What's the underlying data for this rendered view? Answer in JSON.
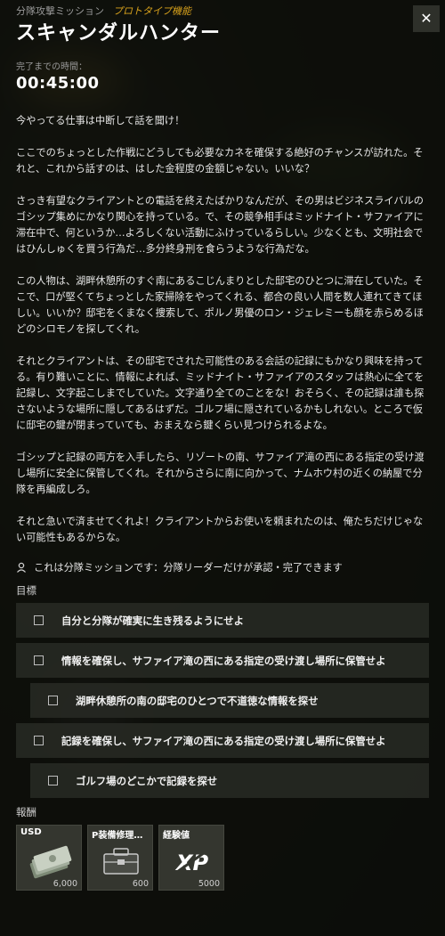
{
  "header": {
    "category": "分隊攻撃ミッション",
    "prototype_tag": "プロトタイプ機能",
    "title": "スキャンダルハンター",
    "close_icon": "close-icon"
  },
  "timer": {
    "label": "完了までの時間：",
    "value": "00:45:00"
  },
  "description": [
    "今やってる仕事は中断して話を聞け！",
    "ここでのちょっとした作戦にどうしても必要なカネを確保する絶好のチャンスが訪れた。それと、これから話すのは、はした金程度の金額じゃない。いいな？",
    "さっき有望なクライアントとの電話を終えたばかりなんだが、その男はビジネスライバルのゴシップ集めにかなり関心を持っている。で、その競争相手はミッドナイト・サファイアに滞在中で、何というか…よろしくない活動にふけっているらしい。少なくとも、文明社会ではひんしゅくを買う行為だ…多分終身刑を食らうような行為だな。",
    "この人物は、湖畔休憩所のすぐ南にあるこじんまりとした邸宅のひとつに滞在していた。そこで、口が堅くてちょっとした家掃除をやってくれる、都合の良い人間を数人連れてきてほしい。いいか？邸宅をくまなく捜索して、ポルノ男優のロン・ジェレミーも顔を赤らめるほどのシロモノを探してくれ。",
    "それとクライアントは、その邸宅でされた可能性のある会話の記録にもかなり興味を持ってる。有り難いことに、情報によれば、ミッドナイト・サファイアのスタッフは熱心に全てを記録し、文字起こしまでしていた。文字通り全てのことをな！おそらく、その記録は誰も探さないような場所に隠してあるはずだ。ゴルフ場に隠されているかもしれない。ところで仮に邸宅の鍵が閉まっていても、おまえなら鍵くらい見つけられるよな。",
    "ゴシップと記録の両方を入手したら、リゾートの南、サファイア滝の西にある指定の受け渡し場所に安全に保管してくれ。それからさらに南に向かって、ナムホウ村の近くの納屋で分隊を再編成しろ。",
    "それと急いで済ませてくれよ！クライアントからお使いを頼まれたのは、俺たちだけじゃない可能性もあるからな。"
  ],
  "squad_note": {
    "icon": "squad-leader-icon",
    "text": "これは分隊ミッションです：分隊リーダーだけが承認・完了できます"
  },
  "objectives": {
    "label": "目標",
    "items": [
      {
        "text": "自分と分隊が確実に生き残るようにせよ",
        "sub": false
      },
      {
        "text": "情報を確保し、サファイア滝の西にある指定の受け渡し場所に保管せよ",
        "sub": false
      },
      {
        "text": "湖畔休憩所の南の邸宅のひとつで不道徳な情報を探せ",
        "sub": true
      },
      {
        "text": "記録を確保し、サファイア滝の西にある指定の受け渡し場所に保管せよ",
        "sub": false
      },
      {
        "text": "ゴルフ場のどこかで記録を探せ",
        "sub": true
      }
    ]
  },
  "rewards": {
    "label": "報酬",
    "items": [
      {
        "name": "USD",
        "amount": "6,000",
        "icon": "cash-stack-icon"
      },
      {
        "name": "P装備修理…",
        "amount": "600",
        "icon": "repair-kit-icon"
      },
      {
        "name": "経験値",
        "amount": "5000",
        "icon": "xp-icon"
      }
    ]
  }
}
